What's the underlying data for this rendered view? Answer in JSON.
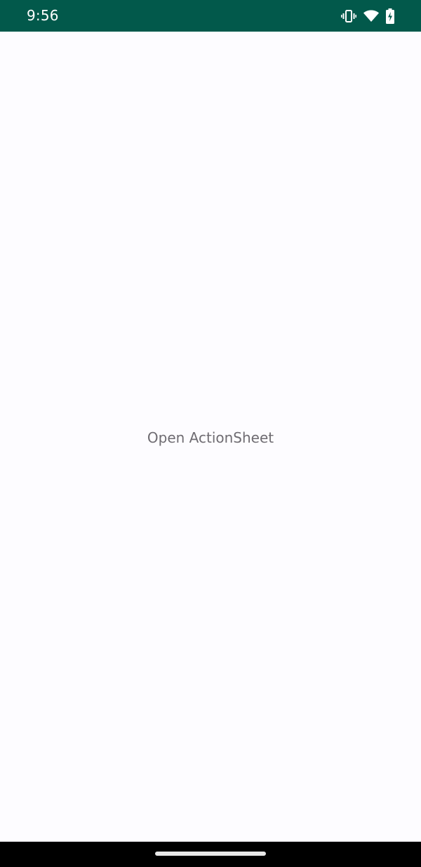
{
  "status_bar": {
    "time": "9:56",
    "background_color": "#02594b",
    "icons": [
      "vibrate-icon",
      "wifi-icon",
      "battery-charging-icon"
    ]
  },
  "main": {
    "open_button_label": "Open ActionSheet",
    "background_color": "#fdfcff"
  },
  "nav_bar": {
    "handle": "home-handle"
  }
}
